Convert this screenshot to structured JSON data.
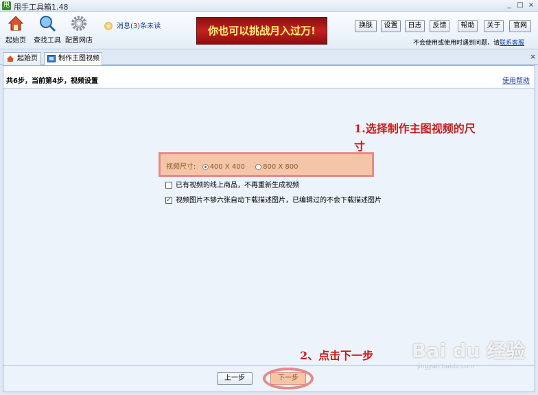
{
  "window": {
    "title": "甩手工具箱",
    "version": "1.48",
    "app_icon_text": "甩",
    "minimize": "_",
    "maximize": "□",
    "close": "×"
  },
  "toolbar": {
    "tools": [
      {
        "label": "起始页",
        "icon": "house-icon"
      },
      {
        "label": "查找工具",
        "icon": "magnifier-icon"
      },
      {
        "label": "配置网店",
        "icon": "gear-icon"
      }
    ],
    "message": {
      "prefix": "消息(",
      "count": "3",
      "suffix": ")条未读"
    },
    "banner": "你也可以挑战月入过万!",
    "buttons": [
      "换肤",
      "设置",
      "日志",
      "反馈",
      "帮助",
      "关于",
      "官网"
    ],
    "notice_text": "不会使用或使用时遇到问题，请",
    "notice_link": "联系客服"
  },
  "tabs": [
    {
      "label": "起始页",
      "icon": "house-icon",
      "active": false
    },
    {
      "label": "制作主图视频",
      "icon": "film-icon",
      "active": true
    }
  ],
  "tab_close": "×",
  "step": {
    "text": "共6步，当前第4步，视频设置",
    "help": "使用帮助"
  },
  "annotations": {
    "a1_line1": "1.选择制作主图视频的尺",
    "a1_line2": "寸",
    "a2": "2、点击下一步"
  },
  "video_size": {
    "label": "视频尺寸:",
    "options": [
      {
        "label": "400 X 400",
        "selected": true
      },
      {
        "label": "800 X 800",
        "selected": false
      }
    ]
  },
  "checkboxes": [
    {
      "label": "已有视频的线上商品，不再重新生成视频",
      "checked": false
    },
    {
      "label": "视频图片不够六张自动下载描述图片，已编辑过的不会下载描述图片",
      "checked": true
    }
  ],
  "footer": {
    "prev": "上一步",
    "next": "下一步"
  },
  "watermark": {
    "logo": "Bai du 经验",
    "url": "jingyan.baidu.com"
  }
}
